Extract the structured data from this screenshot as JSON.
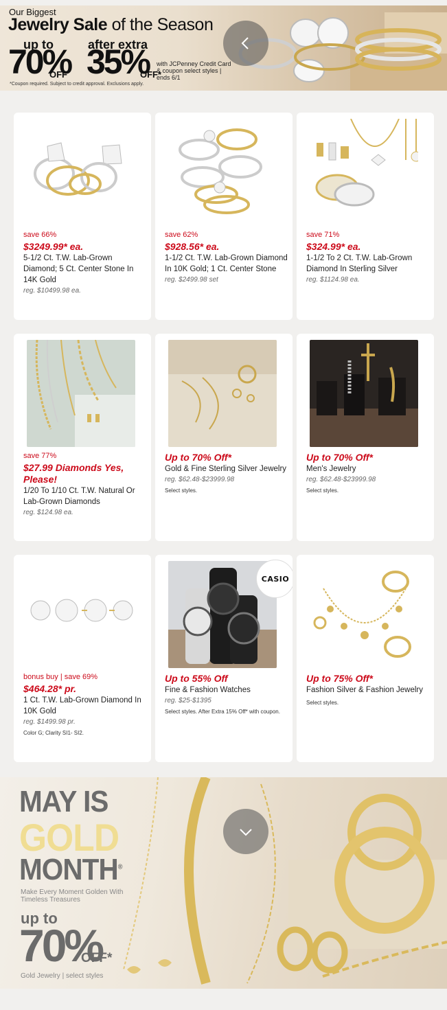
{
  "top_banner": {
    "line1": "Our Biggest",
    "headline_bold": "Jewelry Sale",
    "headline_rest": " of the Season",
    "up_to": "up to",
    "pct1": "70%",
    "off1": "OFF",
    "after_extra": "after extra",
    "pct2": "35%",
    "off2": "OFF*",
    "with_text": "with JCPenney Credit Card & coupon select styles | ends 6/1",
    "fine_print": "*Coupon required. Subject to credit approval. Exclusions apply."
  },
  "products": [
    {
      "save": "save 66%",
      "price": "$3249.99* ea.",
      "name": "5-1/2 Ct. T.W. Lab-Grown Diamond; 5 Ct. Center Stone In 14K Gold",
      "reg": "reg. $10499.98 ea.",
      "note": ""
    },
    {
      "save": "save 62%",
      "price": "$928.56* ea.",
      "name": "1-1/2 Ct. T.W. Lab-Grown Diamond In 10K Gold; 1 Ct. Center Stone",
      "reg": "reg. $2499.98 set",
      "note": ""
    },
    {
      "save": "save 71%",
      "price": "$324.99* ea.",
      "name": "1-1/2 To 2 Ct. T.W. Lab-Grown Diamond In Sterling Silver",
      "reg": "reg. $1124.98 ea.",
      "note": ""
    },
    {
      "save": "save 77%",
      "price": "$27.99 Diamonds Yes, Please!",
      "name": "1/20 To 1/10 Ct. T.W. Natural Or Lab-Grown Diamonds",
      "reg": "reg. $124.98 ea.",
      "note": ""
    },
    {
      "save": "",
      "price": "Up to 70% Off*",
      "name": "Gold & Fine Sterling Silver Jewelry",
      "reg": "reg. $62.48-$23999.98",
      "note": "Select styles."
    },
    {
      "save": "",
      "price": "Up to 70% Off*",
      "name": "Men's Jewelry",
      "reg": "reg. $62.48-$23999.98",
      "note": "Select styles."
    },
    {
      "save": "bonus buy | save 69%",
      "price": "$464.28* pr.",
      "name": "1 Ct. T.W. Lab-Grown Diamond In 10K Gold",
      "reg": "reg. $1499.98 pr.",
      "note": "Color G; Clarity SI1- SI2."
    },
    {
      "save": "",
      "price": "Up to 55% Off",
      "name": "Fine & Fashion Watches",
      "reg": "reg. $25-$1395",
      "note": "Select styles. After Extra 15% Off* with coupon."
    },
    {
      "save": "",
      "price": "Up to 75% Off*",
      "name": "Fashion Silver & Fashion Jewelry",
      "reg": "",
      "note": "Select styles."
    }
  ],
  "casio_logo": "CASIO",
  "gold_banner": {
    "line1": "MAY IS",
    "line2": "GOLD",
    "line3": "MONTH",
    "reg_mark": "®",
    "subtitle": "Make Every Moment Golden With Timeless Treasures",
    "up_to": "up to",
    "pct": "70%",
    "off": "OFF*",
    "footer": "Gold Jewelry | select styles"
  },
  "colors": {
    "sale_red": "#cc0a1a",
    "gold_text": "#f0dd93",
    "gray_text": "#6b6b6b"
  },
  "icons": {
    "carousel_prev": "chevron-left-icon",
    "carousel_next": "chevron-down-icon"
  }
}
